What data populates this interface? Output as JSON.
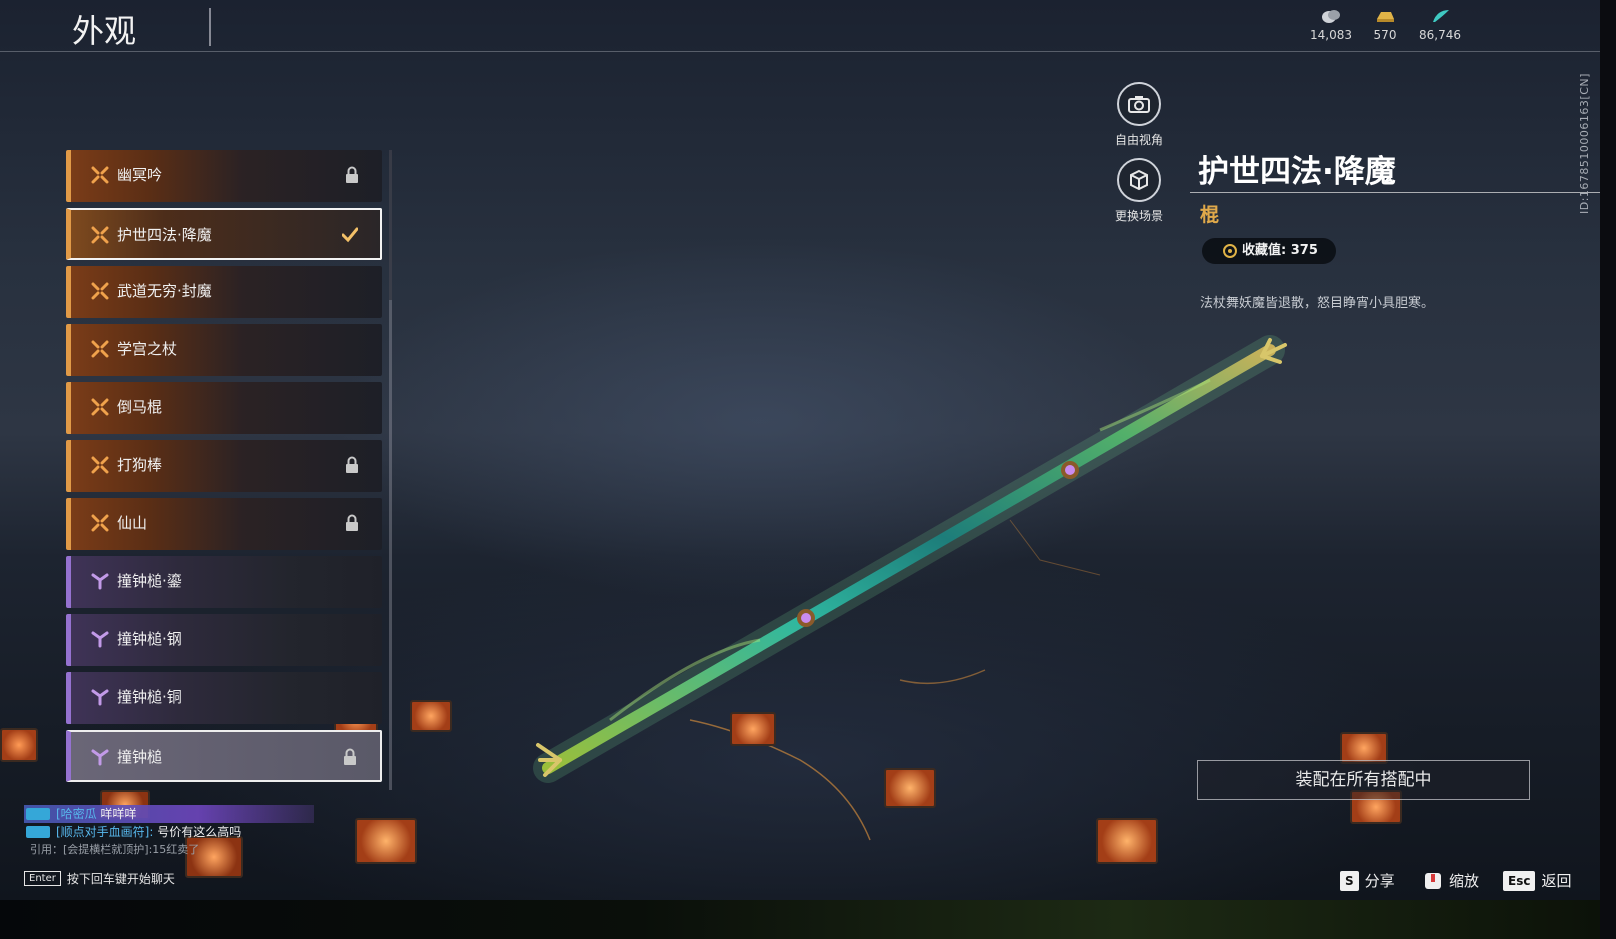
{
  "header": {
    "title": "外观",
    "currencies": [
      {
        "icon": "coin-stack-icon",
        "value": "14,083"
      },
      {
        "icon": "gold-ingot-icon",
        "value": "570"
      },
      {
        "icon": "jade-feather-icon",
        "value": "86,746"
      }
    ]
  },
  "list": {
    "items": [
      {
        "label": "幽冥吟",
        "rarity": "orange",
        "state": "locked"
      },
      {
        "label": "护世四法·降魔",
        "rarity": "orange",
        "state": "equipped"
      },
      {
        "label": "武道无穷·封魔",
        "rarity": "orange",
        "state": "none"
      },
      {
        "label": "学宫之杖",
        "rarity": "orange",
        "state": "none"
      },
      {
        "label": "倒马棍",
        "rarity": "orange",
        "state": "none"
      },
      {
        "label": "打狗棒",
        "rarity": "orange",
        "state": "locked"
      },
      {
        "label": "仙山",
        "rarity": "orange",
        "state": "locked"
      },
      {
        "label": "撞钟槌·鎏",
        "rarity": "purple",
        "state": "none"
      },
      {
        "label": "撞钟槌·钢",
        "rarity": "purple",
        "state": "none"
      },
      {
        "label": "撞钟槌·铜",
        "rarity": "purple",
        "state": "none"
      },
      {
        "label": "撞钟槌",
        "rarity": "purple",
        "state": "locked"
      }
    ]
  },
  "camera": {
    "free_view_label": "自由视角",
    "change_scene_label": "更换场景"
  },
  "detail": {
    "name": "护世四法·降魔",
    "type": "棍",
    "collection_label": "收藏值: 375",
    "description": "法杖舞妖魔皆退散，怒目睁宵小具胆寒。",
    "id_text": "ID:1678510006163[CN]"
  },
  "actions": {
    "equip_all_label": "装配在所有搭配中",
    "share_key": "S",
    "share_label": "分享",
    "zoom_label": "缩放",
    "back_key": "Esc",
    "back_label": "返回"
  },
  "chat": {
    "lines": [
      {
        "name": "[哈密瓜",
        "msg": "咩咩咩"
      },
      {
        "name": "[顺点对手血画符]:",
        "msg": "号价有这么高吗"
      }
    ],
    "quote": "引用：[会提横栏就顶护]:15红卖了",
    "enter_key": "Enter",
    "enter_hint": "按下回车键开始聊天"
  },
  "colors": {
    "orange_accent": "#e19a47",
    "purple_accent": "#9572d0",
    "type_gold": "#e0a94a",
    "chat_name_blue": "#57b8ec"
  }
}
